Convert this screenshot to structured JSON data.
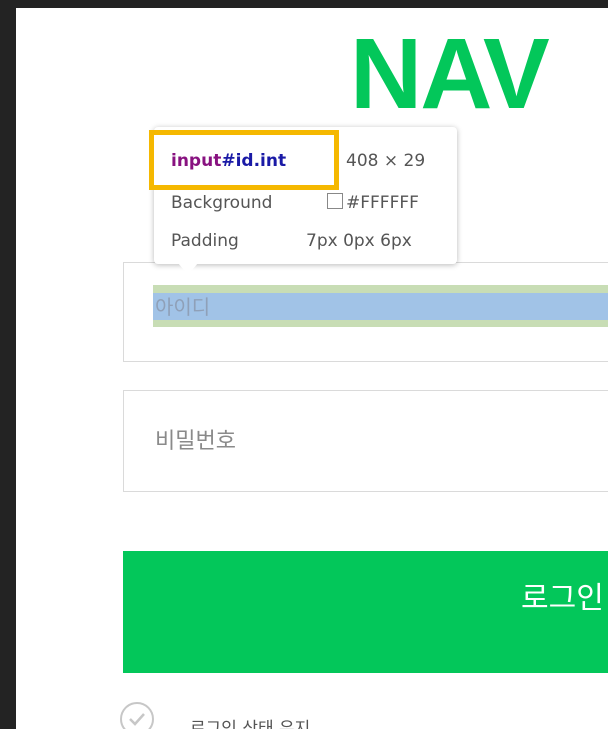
{
  "logo": {
    "text": "NAV",
    "color": "#03c75a"
  },
  "id_field": {
    "placeholder": "아이디"
  },
  "password_field": {
    "placeholder": "비밀번호"
  },
  "login_button": {
    "label": "로그인",
    "color": "#03c75a"
  },
  "keep_login": {
    "label": "로그인 상태 유지"
  },
  "inspector_tooltip": {
    "tag": "input",
    "selector_suffix": "#id.int",
    "size": "408 × 29",
    "background_label": "Background",
    "background_value": "#FFFFFF",
    "padding_label": "Padding",
    "padding_value": "7px 0px 6px",
    "highlight_color": "#f5b800"
  }
}
